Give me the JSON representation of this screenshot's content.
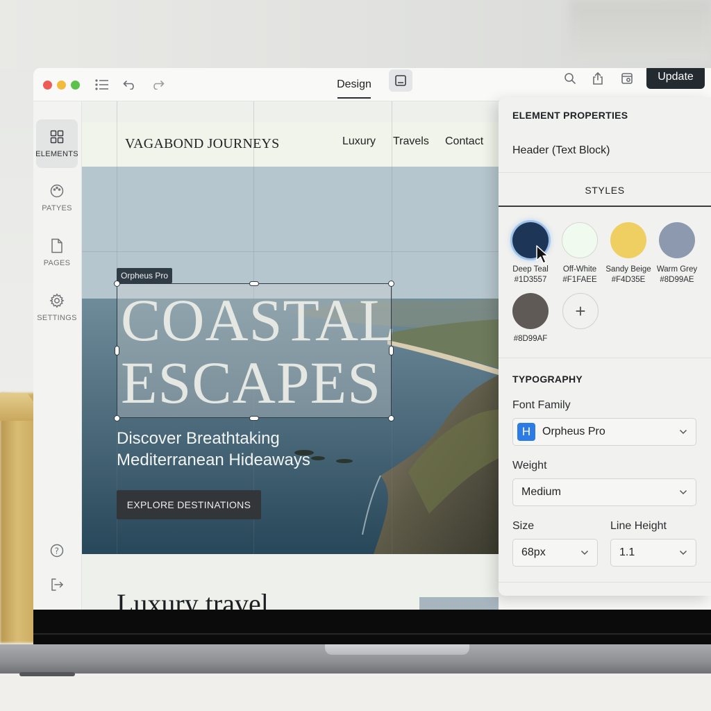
{
  "toolbar": {
    "active_tab": "Design",
    "update_label": "Update"
  },
  "sidebar": {
    "items": [
      {
        "label": "ELEMENTS",
        "icon": "grid-icon"
      },
      {
        "label": "PATYES",
        "icon": "palette-icon"
      },
      {
        "label": "PAGES",
        "icon": "page-icon"
      },
      {
        "label": "SETTINGS",
        "icon": "gear-icon"
      }
    ],
    "bottom_icons": [
      "help-icon",
      "logout-icon"
    ]
  },
  "site": {
    "logo": "VAGABOND JOURNEYS",
    "nav": [
      "Luxury",
      "Travels",
      "Contact"
    ],
    "font_tag": "Orpheus Pro",
    "hero_title": "COASTAL\nESCAPES",
    "hero_subtitle": "Discover Breathtaking\nMediterranean Hideaways",
    "cta": "EXPLORE DESTINATIONS",
    "below_heading": "Luxury travel"
  },
  "panel": {
    "title": "ELEMENT PROPERTIES",
    "element_name": "Header (Text Block)",
    "tab": "STYLES",
    "swatches": [
      {
        "name": "Deep Teal",
        "hex": "#1D3557",
        "color": "#1d3557"
      },
      {
        "name": "Off-White",
        "hex": "#F1FAEE",
        "color": "#f1faee"
      },
      {
        "name": "Sandy Beige",
        "hex": "#F4D35E",
        "color": "#f0cf62"
      },
      {
        "name": "Warm Grey",
        "hex": "#8D99AE",
        "color": "#8d99ae"
      },
      {
        "name": "",
        "hex": "#8D99AF",
        "color": "#5f5a55"
      }
    ],
    "typography": {
      "heading": "TYPOGRAPHY",
      "font_family_label": "Font Family",
      "font_family": "Orpheus Pro",
      "font_badge": "H",
      "weight_label": "Weight",
      "weight": "Medium",
      "size_label": "Size",
      "size": "68px",
      "line_height_label": "Line Height",
      "line_height": "1.1"
    }
  }
}
